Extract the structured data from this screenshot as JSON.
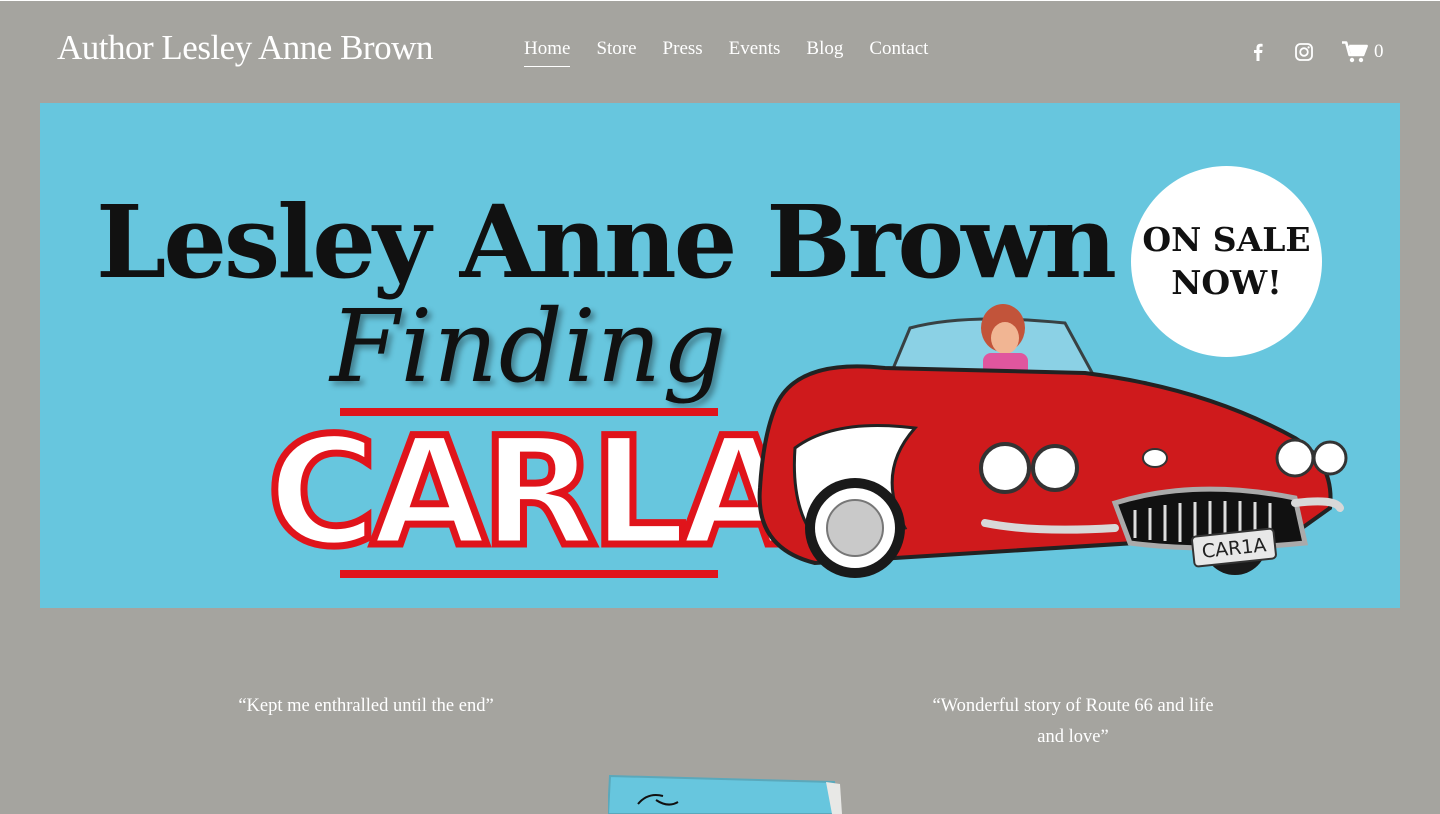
{
  "header": {
    "site_title": "Author Lesley Anne Brown",
    "nav": [
      {
        "label": "Home",
        "active": true
      },
      {
        "label": "Store",
        "active": false
      },
      {
        "label": "Press",
        "active": false
      },
      {
        "label": "Events",
        "active": false
      },
      {
        "label": "Blog",
        "active": false
      },
      {
        "label": "Contact",
        "active": false
      }
    ],
    "social_icons": [
      "facebook-icon",
      "instagram-icon"
    ],
    "cart_count": "0"
  },
  "hero": {
    "author_name": "Lesley Anne Brown",
    "title_script": "Finding",
    "title_main": "CARLA",
    "badge_text": "ON SALE\nNOW!",
    "license_plate": "CAR1A",
    "background_color": "#67c6de",
    "car_color": "#cf1a1c"
  },
  "quotes": [
    {
      "text": "“Kept me enthralled until the end”"
    },
    {
      "text": "“Wonderful story of Route 66 and life and love”"
    }
  ],
  "colors": {
    "page_background": "#a5a49f",
    "text": "#ffffff",
    "accent_red": "#e0141b"
  }
}
